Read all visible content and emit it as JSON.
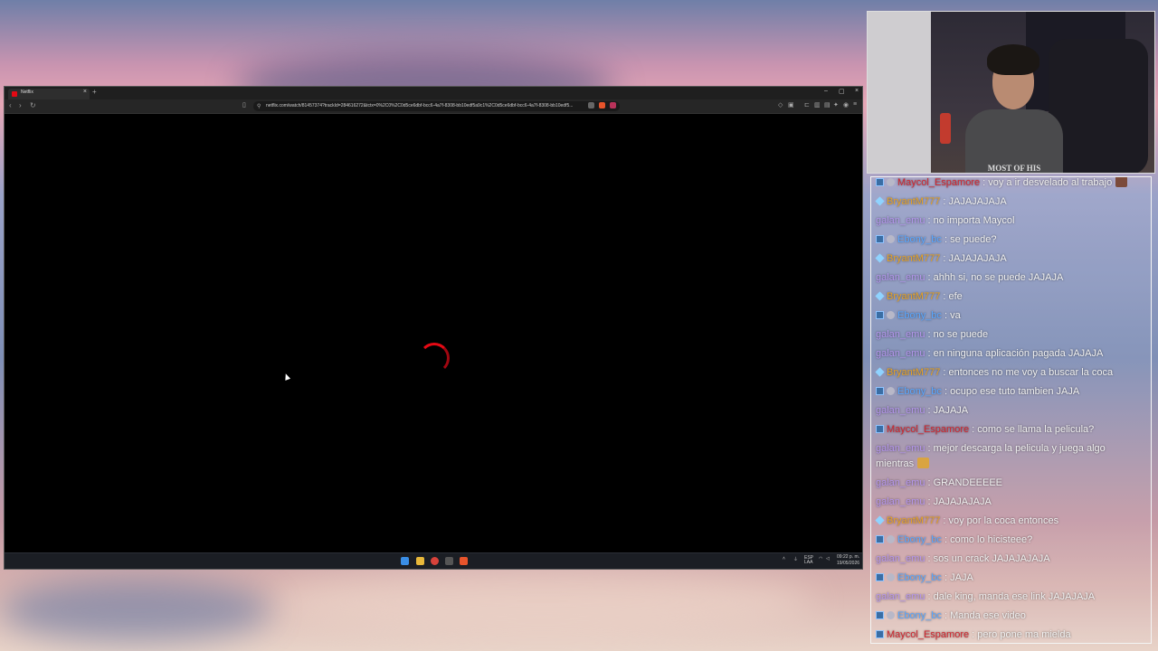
{
  "browser": {
    "tab_title": "Netflix",
    "tab_close": "×",
    "new_tab": "+",
    "url": "netflix.com/watch/81457374?trackId=284616272&tctx=0%2C0%2C0d5ce6dbf-bcc6-4a7f-8308-bb10edf5a9c1%2C0d5ce6dbf-bcc6-4a7f-8308-bb10edf5...",
    "back": "‹",
    "forward": "›",
    "reload": "↻",
    "minimize": "–",
    "maximize": "▢",
    "close": "×"
  },
  "taskbar": {
    "lang": "ESP\nLAA",
    "time": "09:22 p. m.",
    "date": "19/05/2026"
  },
  "webcam": {
    "shirt_text": "MOST OF HIS"
  },
  "colors": {
    "accent_red": "#e50914",
    "user_bryant": "#e8a325",
    "user_galan": "#b697f0",
    "user_ebony": "#59a7ff",
    "user_maycol": "#d3262f"
  },
  "chat": {
    "messages": [
      {
        "user": "Maycol_Espamore",
        "color": "#d3262f",
        "badges": [
          "sq",
          "gear"
        ],
        "text": " : voy a ir desvelado al trabajo",
        "emote": "#7b4a3a"
      },
      {
        "user": "BryantM777",
        "color": "#e8a325",
        "badges": [
          "diamond"
        ],
        "text": " : JAJAJAJAJA"
      },
      {
        "user": "galan_emu",
        "color": "#b697f0",
        "badges": [],
        "text": " : no importa Maycol"
      },
      {
        "user": "Ebony_bc",
        "color": "#59a7ff",
        "badges": [
          "sq",
          "gear"
        ],
        "text": " : se puede?"
      },
      {
        "user": "BryantM777",
        "color": "#e8a325",
        "badges": [
          "diamond"
        ],
        "text": " : JAJAJAJAJA"
      },
      {
        "user": "galan_emu",
        "color": "#b697f0",
        "badges": [],
        "text": " : ahhh si, no se puede JAJAJA"
      },
      {
        "user": "BryantM777",
        "color": "#e8a325",
        "badges": [
          "diamond"
        ],
        "text": " : efe"
      },
      {
        "user": "Ebony_bc",
        "color": "#59a7ff",
        "badges": [
          "sq",
          "gear"
        ],
        "text": " : va"
      },
      {
        "user": "galan_emu",
        "color": "#b697f0",
        "badges": [],
        "text": " : no se puede"
      },
      {
        "user": "galan_emu",
        "color": "#b697f0",
        "badges": [],
        "text": " : en ninguna aplicación pagada JAJAJA"
      },
      {
        "user": "BryantM777",
        "color": "#e8a325",
        "badges": [
          "diamond"
        ],
        "text": " : entonces no me voy a buscar la coca"
      },
      {
        "user": "Ebony_bc",
        "color": "#59a7ff",
        "badges": [
          "sq",
          "gear"
        ],
        "text": " : ocupo ese tuto tambien JAJA"
      },
      {
        "user": "galan_emu",
        "color": "#b697f0",
        "badges": [],
        "text": " : JAJAJA"
      },
      {
        "user": "Maycol_Espamore",
        "color": "#d3262f",
        "badges": [
          "sq"
        ],
        "text": " : como se llama la pelicula?"
      },
      {
        "user": "galan_emu",
        "color": "#b697f0",
        "badges": [],
        "text": " : mejor descarga la pelicula y juega algo mientras",
        "emote": "#d9a441",
        "two_line": true
      },
      {
        "user": "galan_emu",
        "color": "#b697f0",
        "badges": [],
        "text": " : GRANDEEEEE"
      },
      {
        "user": "galan_emu",
        "color": "#b697f0",
        "badges": [],
        "text": " : JAJAJAJAJA"
      },
      {
        "user": "BryantM777",
        "color": "#e8a325",
        "badges": [
          "diamond"
        ],
        "text": " : voy por la coca entonces"
      },
      {
        "user": "Ebony_bc",
        "color": "#59a7ff",
        "badges": [
          "sq",
          "gear"
        ],
        "text": " : como lo hicisteee?"
      },
      {
        "user": "galan_emu",
        "color": "#b697f0",
        "badges": [],
        "text": " : sos un crack JAJAJAJAJA"
      },
      {
        "user": "Ebony_bc",
        "color": "#59a7ff",
        "badges": [
          "sq",
          "gear"
        ],
        "text": " : JAJA"
      },
      {
        "user": "galan_emu",
        "color": "#b697f0",
        "badges": [],
        "text": " : dale king, manda ese link JAJAJAJA"
      },
      {
        "user": "Ebony_bc",
        "color": "#59a7ff",
        "badges": [
          "sq",
          "gear"
        ],
        "text": " : Manda ese video"
      },
      {
        "user": "Maycol_Espamore",
        "color": "#d3262f",
        "badges": [
          "sq"
        ],
        "text": " : pero pone ma mielda"
      }
    ]
  }
}
